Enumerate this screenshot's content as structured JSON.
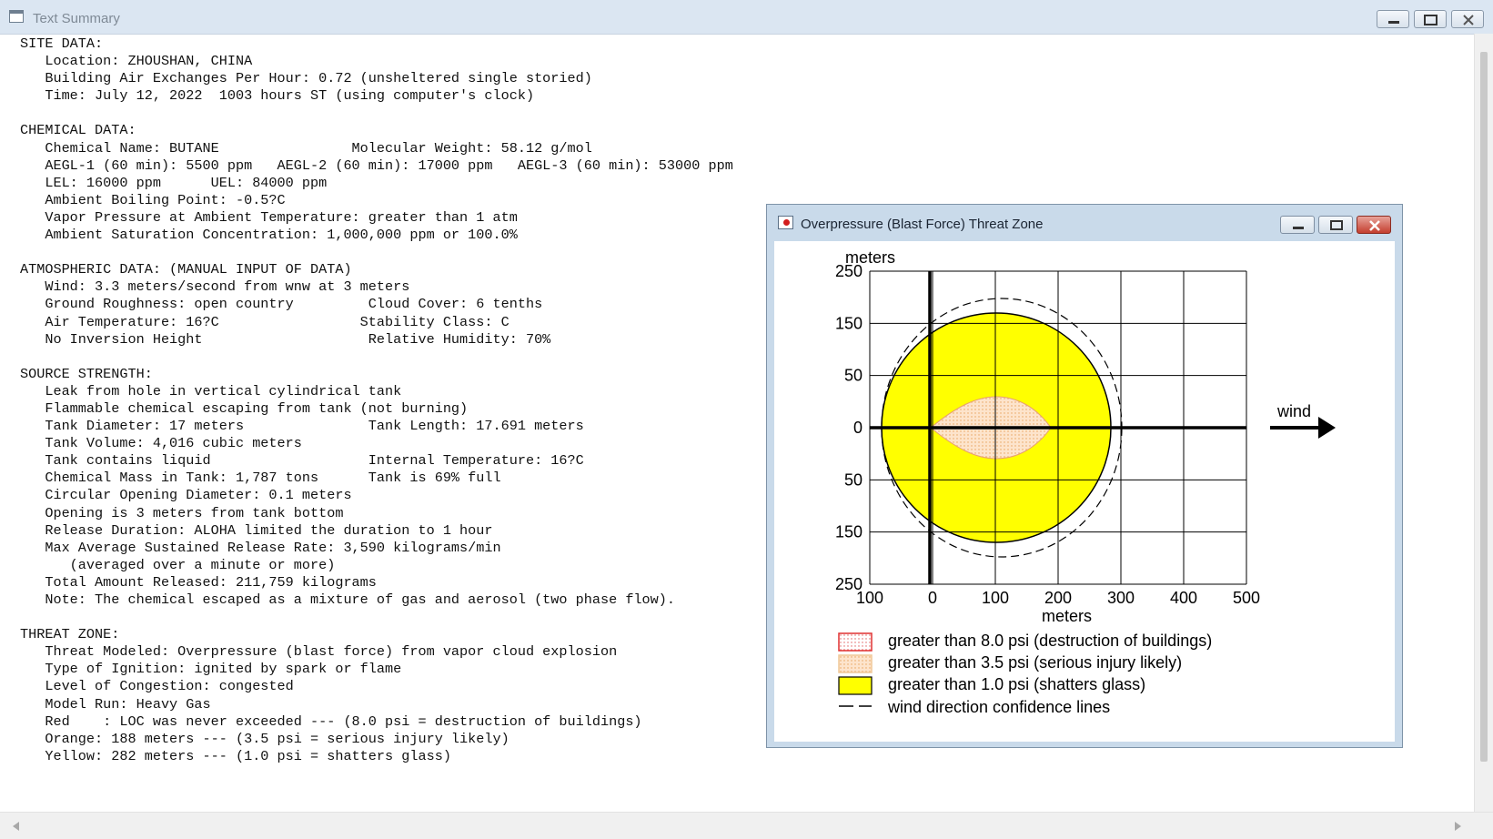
{
  "main_window": {
    "title": "Text Summary",
    "controls": {
      "minimize": "minimize",
      "maximize": "maximize",
      "close": "close"
    }
  },
  "summary_lines": [
    "SITE DATA:",
    "   Location: ZHOUSHAN, CHINA",
    "   Building Air Exchanges Per Hour: 0.72 (unsheltered single storied)",
    "   Time: July 12, 2022  1003 hours ST (using computer's clock)",
    "",
    "CHEMICAL DATA:",
    "   Chemical Name: BUTANE                Molecular Weight: 58.12 g/mol",
    "   AEGL-1 (60 min): 5500 ppm   AEGL-2 (60 min): 17000 ppm   AEGL-3 (60 min): 53000 ppm",
    "   LEL: 16000 ppm      UEL: 84000 ppm",
    "   Ambient Boiling Point: -0.5?C",
    "   Vapor Pressure at Ambient Temperature: greater than 1 atm",
    "   Ambient Saturation Concentration: 1,000,000 ppm or 100.0%",
    "",
    "ATMOSPHERIC DATA: (MANUAL INPUT OF DATA)",
    "   Wind: 3.3 meters/second from wnw at 3 meters",
    "   Ground Roughness: open country         Cloud Cover: 6 tenths",
    "   Air Temperature: 16?C                 Stability Class: C",
    "   No Inversion Height                    Relative Humidity: 70%",
    "",
    "SOURCE STRENGTH:",
    "   Leak from hole in vertical cylindrical tank",
    "   Flammable chemical escaping from tank (not burning)",
    "   Tank Diameter: 17 meters               Tank Length: 17.691 meters",
    "   Tank Volume: 4,016 cubic meters",
    "   Tank contains liquid                   Internal Temperature: 16?C",
    "   Chemical Mass in Tank: 1,787 tons      Tank is 69% full",
    "   Circular Opening Diameter: 0.1 meters",
    "   Opening is 3 meters from tank bottom",
    "   Release Duration: ALOHA limited the duration to 1 hour",
    "   Max Average Sustained Release Rate: 3,590 kilograms/min",
    "      (averaged over a minute or more)",
    "   Total Amount Released: 211,759 kilograms",
    "   Note: The chemical escaped as a mixture of gas and aerosol (two phase flow).",
    "",
    "THREAT ZONE:",
    "   Threat Modeled: Overpressure (blast force) from vapor cloud explosion",
    "   Type of Ignition: ignited by spark or flame",
    "   Level of Congestion: congested",
    "   Model Run: Heavy Gas",
    "   Red    : LOC was never exceeded --- (8.0 psi = destruction of buildings)",
    "   Orange: 188 meters --- (3.5 psi = serious injury likely)",
    "   Yellow: 282 meters --- (1.0 psi = shatters glass)"
  ],
  "threat_window": {
    "title": "Overpressure (Blast Force) Threat Zone",
    "wind_label": "wind",
    "legend": [
      {
        "label": "greater than 8.0 psi (destruction of buildings)",
        "swatch": "red-dotted"
      },
      {
        "label": "greater than 3.5 psi (serious injury likely)",
        "swatch": "orange-dotted"
      },
      {
        "label": "greater than 1.0 psi (shatters glass)",
        "swatch": "yellow"
      },
      {
        "label": "wind direction confidence lines",
        "swatch": "dash-line"
      }
    ],
    "colors": {
      "yellow_zone": "#ffff00",
      "orange_zone": "#fde2c8",
      "red_border": "#e03030",
      "orange_dots": "#e8b070"
    }
  },
  "chart_data": {
    "type": "threat-zone-map",
    "xlabel": "meters",
    "ylabel": "meters",
    "x_ticks": [
      100,
      0,
      100,
      200,
      300,
      400,
      500
    ],
    "y_ticks": [
      250,
      150,
      50,
      0,
      50,
      150,
      250
    ],
    "xlim": [
      -100,
      500
    ],
    "ylim": [
      -250,
      250
    ],
    "zones": [
      {
        "name": "Yellow",
        "psi": 1.0,
        "radius_m": 282
      },
      {
        "name": "Orange",
        "psi": 3.5,
        "radius_m": 188
      },
      {
        "name": "Red",
        "psi": 8.0,
        "radius_m": null
      }
    ]
  }
}
